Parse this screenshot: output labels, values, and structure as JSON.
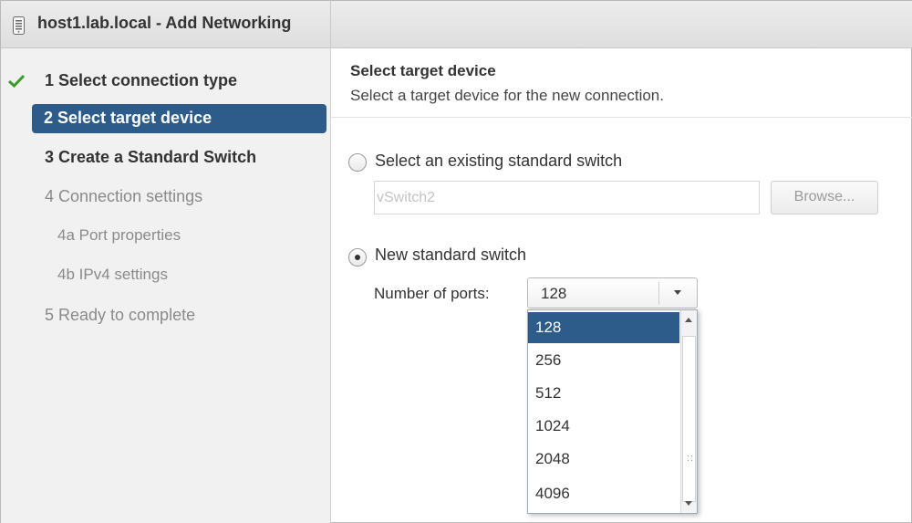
{
  "window": {
    "title": "host1.lab.local - Add Networking",
    "icon": "server-icon"
  },
  "colors": {
    "accent": "#2d5b8a",
    "check": "#3c9a2c",
    "sidebar_bg": "#f1f1f1"
  },
  "wizard": {
    "steps": [
      {
        "label": "1  Select connection type",
        "state": "done"
      },
      {
        "label": "2  Select target device",
        "state": "active"
      },
      {
        "label": "3  Create a Standard Switch",
        "state": "next"
      },
      {
        "label": "4  Connection settings",
        "state": "disabled"
      },
      {
        "label": "4a  Port properties",
        "state": "disabled-sub"
      },
      {
        "label": "4b  IPv4 settings",
        "state": "disabled-sub"
      },
      {
        "label": "5  Ready to complete",
        "state": "disabled"
      }
    ]
  },
  "content": {
    "title": "Select target device",
    "subtitle": "Select a target device for the new connection.",
    "existing_switch": {
      "label": "Select an existing standard switch",
      "selected": false,
      "value": "vSwitch2",
      "browse_label": "Browse..."
    },
    "new_switch": {
      "label": "New standard switch",
      "selected": true,
      "ports_label": "Number of ports:",
      "ports_value": "128",
      "options": [
        "128",
        "256",
        "512",
        "1024",
        "2048",
        "4096"
      ]
    }
  }
}
